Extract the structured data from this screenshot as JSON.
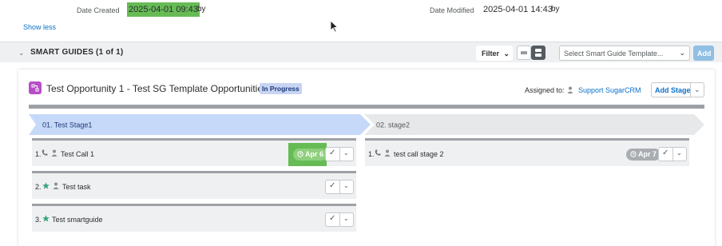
{
  "record": {
    "date_created_label": "Date Created",
    "date_created_value": "2025-04-01 09:43",
    "date_created_by": "by",
    "date_modified_label": "Date Modified",
    "date_modified_value": "2025-04-01 14:43",
    "date_modified_by": "by",
    "show_less": "Show less"
  },
  "smart_guides": {
    "header_title": "SMART GUIDES (1 of 1)",
    "filter_label": "Filter",
    "template_placeholder": "Select Smart Guide Template...",
    "add_label": "Add"
  },
  "guide": {
    "title": "Test Opportunity 1 - Test SG Template Opportunities",
    "status": "In Progress",
    "assigned_label": "Assigned to:",
    "assigned_user": "Support SugarCRM",
    "add_stage_label": "Add Stage",
    "stages": [
      {
        "name": "01. Test Stage1",
        "active": true,
        "tasks": [
          {
            "number": "1.",
            "name": "Test Call 1",
            "type": "call",
            "due": "Apr 6",
            "highlighted": true
          },
          {
            "number": "2.",
            "name": "Test task",
            "type": "task",
            "due": ""
          },
          {
            "number": "3.",
            "name": "Test smartguide",
            "type": "smartguide",
            "due": ""
          }
        ]
      },
      {
        "name": "02. stage2",
        "active": false,
        "tasks": [
          {
            "number": "1.",
            "name": "test call stage 2",
            "type": "call",
            "due": "Apr 7"
          }
        ]
      }
    ]
  },
  "colors": {
    "highlight": "#66bb55",
    "active_stage": "#c7d9f8",
    "inactive_stage": "#e6e8ea",
    "link": "#0b70c9",
    "guide_icon": "#b64ec6",
    "star": "#3aa37a"
  }
}
